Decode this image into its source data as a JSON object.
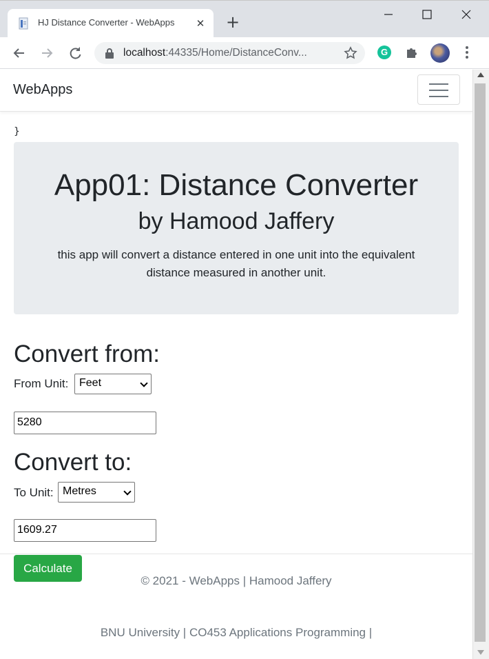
{
  "browser": {
    "tab_title": "HJ Distance Converter - WebApps",
    "url_host": "localhost",
    "url_rest": ":44335/Home/DistanceConv..."
  },
  "site": {
    "brand": "WebApps",
    "stray_text": "}"
  },
  "jumbotron": {
    "title": "App01: Distance Converter",
    "subtitle": "by Hamood Jaffery",
    "description": "this app will convert a distance entered in one unit into the equivalent distance measured in another unit."
  },
  "converter": {
    "from_heading": "Convert from:",
    "from_label": "From Unit:",
    "from_unit": "Feet",
    "from_value": "5280",
    "to_heading": "Convert to:",
    "to_label": "To Unit:",
    "to_unit": "Metres",
    "to_value": "1609.27",
    "calculate_label": "Calculate"
  },
  "footer": {
    "copyright": "© 2021 - WebApps | Hamood Jaffery",
    "course": "BNU University | CO453 Applications Programming |"
  },
  "colors": {
    "calculate_button": "#28a745",
    "jumbotron_bg": "#e9ecef",
    "grammarly": "#15c39a"
  },
  "icons": [
    "page-favicon-icon",
    "close-icon",
    "plus-icon",
    "minimize-icon",
    "maximize-icon",
    "window-close-icon",
    "back-arrow-icon",
    "forward-arrow-icon",
    "reload-icon",
    "lock-icon",
    "star-icon",
    "grammarly-icon",
    "puzzle-icon",
    "kebab-menu-icon",
    "hamburger-icon"
  ]
}
